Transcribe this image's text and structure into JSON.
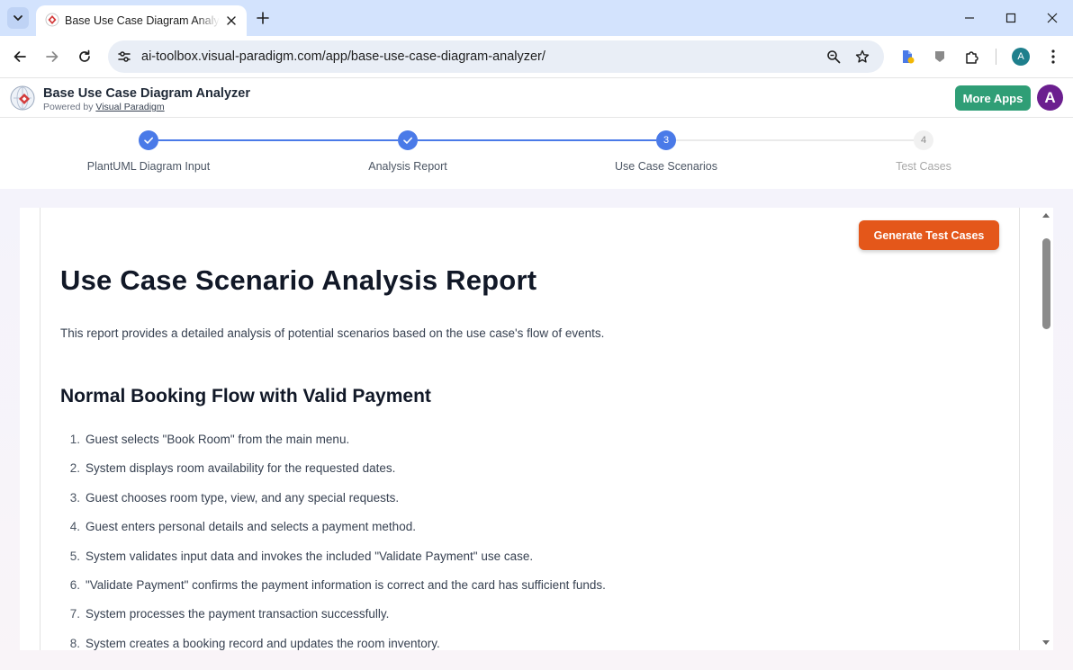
{
  "browser": {
    "tab_title": "Base Use Case Diagram Analyzer",
    "url": "ai-toolbox.visual-paradigm.com/app/base-use-case-diagram-analyzer/",
    "profile_initial": "A"
  },
  "app": {
    "title": "Base Use Case Diagram Analyzer",
    "powered_prefix": "Powered by",
    "powered_link": "Visual Paradigm",
    "more_apps_label": "More Apps",
    "avatar_initial": "A"
  },
  "stepper": {
    "steps": [
      {
        "number": "1",
        "label": "PlantUML Diagram Input",
        "status": "done"
      },
      {
        "number": "2",
        "label": "Analysis Report",
        "status": "done"
      },
      {
        "number": "3",
        "label": "Use Case Scenarios",
        "status": "active"
      },
      {
        "number": "4",
        "label": "Test Cases",
        "status": "pending"
      }
    ]
  },
  "report": {
    "generate_button": "Generate Test Cases",
    "title": "Use Case Scenario Analysis Report",
    "intro": "This report provides a detailed analysis of potential scenarios based on the use case's flow of events.",
    "section_title": "Normal Booking Flow with Valid Payment",
    "steps": [
      {
        "num": "1.",
        "text": "Guest selects \"Book Room\" from the main menu."
      },
      {
        "num": "2.",
        "text": "System displays room availability for the requested dates."
      },
      {
        "num": "3.",
        "text": "Guest chooses room type, view, and any special requests."
      },
      {
        "num": "4.",
        "text": "Guest enters personal details and selects a payment method."
      },
      {
        "num": "5.",
        "text": "System validates input data and invokes the included \"Validate Payment\" use case."
      },
      {
        "num": "6.",
        "text": "\"Validate Payment\" confirms the payment information is correct and the card has sufficient funds."
      },
      {
        "num": "7.",
        "text": "System processes the payment transaction successfully."
      },
      {
        "num": "8.",
        "text": "System creates a booking record and updates the room inventory."
      }
    ]
  },
  "colors": {
    "accent_blue": "#4a7ae8",
    "more_apps_green": "#2f9e76",
    "generate_orange": "#e4571a",
    "avatar_purple": "#6b1f8f"
  }
}
